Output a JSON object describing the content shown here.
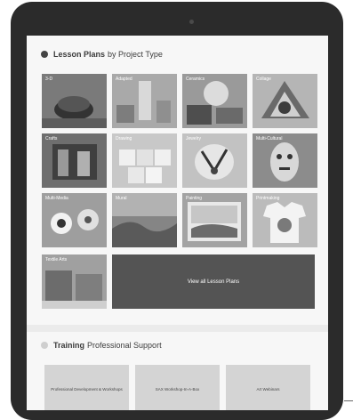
{
  "lesson_plans": {
    "heading_bold": "Lesson Plans",
    "heading_rest": "by Project Type",
    "categories": [
      {
        "label": "3-D",
        "shade": "#7a7a7a"
      },
      {
        "label": "Adapted",
        "shade": "#a9a9a9"
      },
      {
        "label": "Ceramics",
        "shade": "#9a9a9a"
      },
      {
        "label": "Collage",
        "shade": "#b5b5b5"
      },
      {
        "label": "Crafts",
        "shade": "#6e6e6e"
      },
      {
        "label": "Drawing",
        "shade": "#c8c8c8"
      },
      {
        "label": "Jewelry",
        "shade": "#c2c2c2"
      },
      {
        "label": "Multi-Cultural",
        "shade": "#8c8c8c"
      },
      {
        "label": "Multi-Media",
        "shade": "#9e9e9e"
      },
      {
        "label": "Mural",
        "shade": "#858585"
      },
      {
        "label": "Painting",
        "shade": "#a3a3a3"
      },
      {
        "label": "Printmaking",
        "shade": "#bbbbbb"
      },
      {
        "label": "Textile Arts",
        "shade": "#a0a0a0"
      }
    ],
    "view_all_label": "View all Lesson Plans"
  },
  "training": {
    "heading_bold": "Training",
    "heading_rest": "Professional Support",
    "cards": [
      {
        "label": "Professional Development & Workshops"
      },
      {
        "label": "SAX Workshop-In-A-Box"
      },
      {
        "label": "Art Webinars"
      }
    ]
  }
}
